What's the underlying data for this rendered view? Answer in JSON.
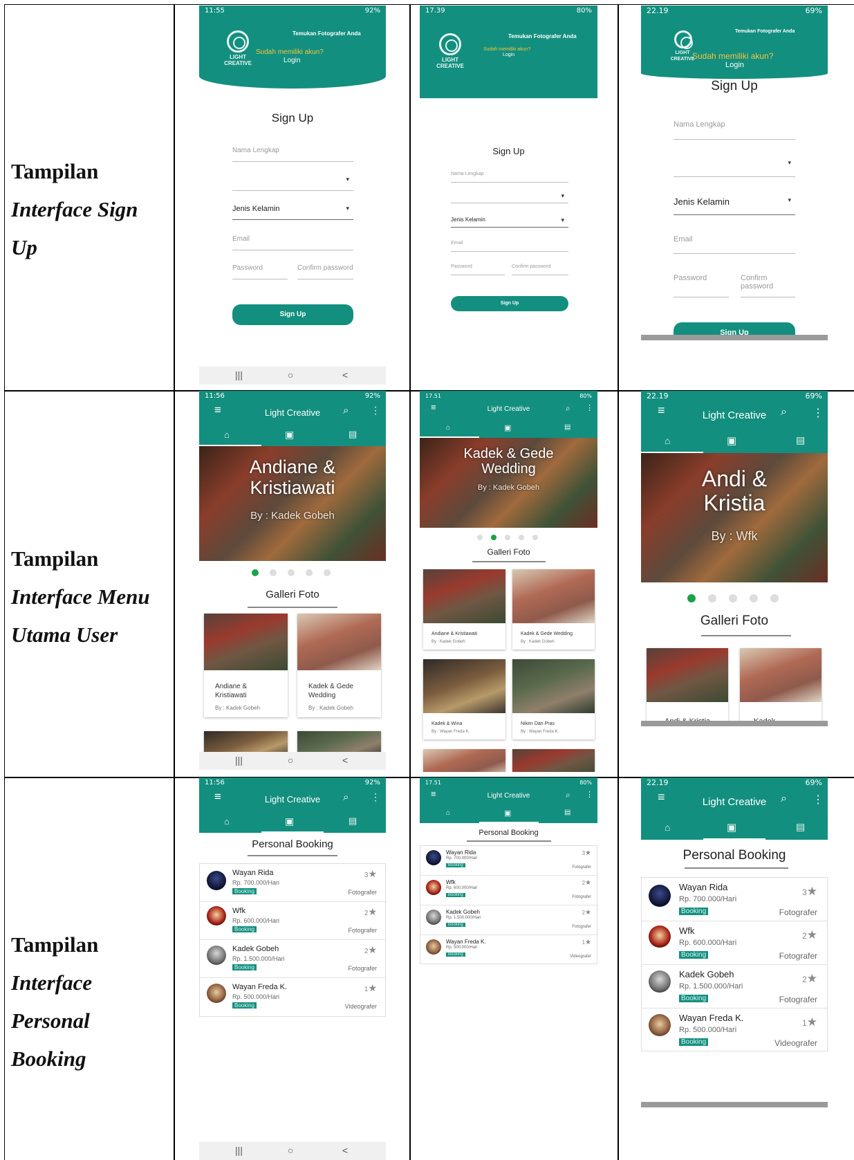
{
  "rows": [
    {
      "label_first": "Tampilan",
      "label_rest": "Interface Sign\nUp"
    },
    {
      "label_first": "Tampilan",
      "label_rest": "Interface Menu\nUtama User"
    },
    {
      "label_first": "Tampilan",
      "label_rest": "Interface\nPersonal\nBooking"
    }
  ],
  "status": {
    "a": {
      "time": "11:55",
      "time2": "11:56",
      "right": "92%"
    },
    "b": {
      "time": "17.39",
      "time2": "17.51",
      "right": "80%"
    },
    "c": {
      "time": "22.19",
      "right": "69%"
    }
  },
  "navbar": {
    "recents": "|||",
    "home": "○",
    "back": "<"
  },
  "signup": {
    "logo_text": "LIGHT\nCREATIVE",
    "tagline": "Temukan Fotografer Anda",
    "have_account": "Sudah memiliki akun?",
    "login": "Login",
    "title": "Sign Up",
    "full_name_placeholder": "Nama Lengkap",
    "gender": "Jenis Kelamin",
    "email_placeholder": "Email",
    "password_placeholder": "Password",
    "confirm_placeholder": "Confirm password",
    "button": "Sign Up"
  },
  "home": {
    "app_title": "Light Creative",
    "gallery_title": "Galleri Foto",
    "banner_a": {
      "title": "Andiane &\nKristiawati",
      "by": "By : Kadek Gobeh"
    },
    "banner_b": {
      "title": "Kadek & Gede\nWedding",
      "by": "By : Kadek Gobeh"
    },
    "banner_c": {
      "title": "Andi &\nKristia",
      "by": "By : Wfk"
    },
    "cards_a": [
      {
        "name": "Andiane &\nKristiawati",
        "by": "By : Kadek Gobeh"
      },
      {
        "name": "Kadek & Gede\nWedding",
        "by": "By : Kadek Gobeh"
      }
    ],
    "cards_b": [
      {
        "name": "Andiane & Kristiawati",
        "by": "By : Kadek Gobeh"
      },
      {
        "name": "Kadek & Gede Wedding",
        "by": "By : Kadek Gobeh"
      },
      {
        "name": "Kadek & Wina",
        "by": "By : Wayan Freda K."
      },
      {
        "name": "Niken Dan Pras",
        "by": "By : Wayan Freda K."
      }
    ],
    "cards_c": [
      {
        "name": "Andi & Kristia"
      },
      {
        "name": "Kadek"
      }
    ]
  },
  "booking": {
    "title": "Personal Booking",
    "badge": "Booking",
    "items": [
      {
        "name": "Wayan Rida",
        "price": "Rp. 700.000/Hari",
        "rating": "3",
        "role": "Fotografer"
      },
      {
        "name": "Wfk",
        "price": "Rp. 600.000/Hari",
        "rating": "2",
        "role": "Fotografer"
      },
      {
        "name": "Kadek Gobeh",
        "price": "Rp. 1.500.000/Hari",
        "rating": "2",
        "role": "Fotografer"
      },
      {
        "name": "Wayan Freda K.",
        "price": "Rp. 500.000/Hari",
        "rating": "1",
        "role": "Videografer"
      }
    ]
  },
  "colors": {
    "primary": "#138f7f",
    "accent_yellow": "#f6c33b",
    "active_dot": "#1aa34a"
  }
}
